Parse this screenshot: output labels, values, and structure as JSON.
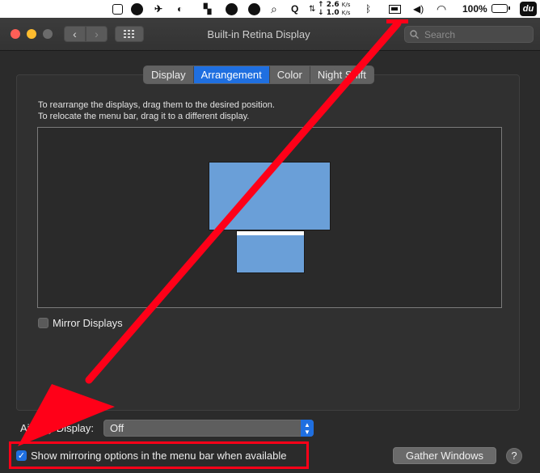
{
  "menubar": {
    "net_up": "2.6",
    "net_down": "1.0",
    "net_unit": "K/s",
    "battery_percent": "100%",
    "app_badge": "du",
    "icons": [
      "finder-box-icon",
      "gamepad-icon",
      "bird-icon",
      "wechat-icon",
      "bookmark-icon",
      "toolbox-icon",
      "leaf-icon",
      "magnifier-icon",
      "q-icon",
      "network-arrows-icon",
      "bluetooth-icon",
      "airplay-display-icon",
      "volume-icon",
      "wifi-icon",
      "battery-icon"
    ]
  },
  "window": {
    "title": "Built-in Retina Display",
    "search_placeholder": "Search"
  },
  "tabs": [
    {
      "label": "Display",
      "active": false
    },
    {
      "label": "Arrangement",
      "active": true
    },
    {
      "label": "Color",
      "active": false
    },
    {
      "label": "Night Shift",
      "active": false
    }
  ],
  "instructions": {
    "line1": "To rearrange the displays, drag them to the desired position.",
    "line2": "To relocate the menu bar, drag it to a different display."
  },
  "mirror_displays": {
    "label": "Mirror Displays",
    "checked": false
  },
  "airplay": {
    "label": "AirPlay Display:",
    "value": "Off"
  },
  "mirroring_option": {
    "label": "Show mirroring options in the menu bar when available",
    "checked": true
  },
  "gather_windows_label": "Gather Windows",
  "help_label": "?",
  "colors": {
    "accent": "#1f6fe0",
    "annotation": "#ff0018",
    "display_blue": "#6a9fd8"
  }
}
